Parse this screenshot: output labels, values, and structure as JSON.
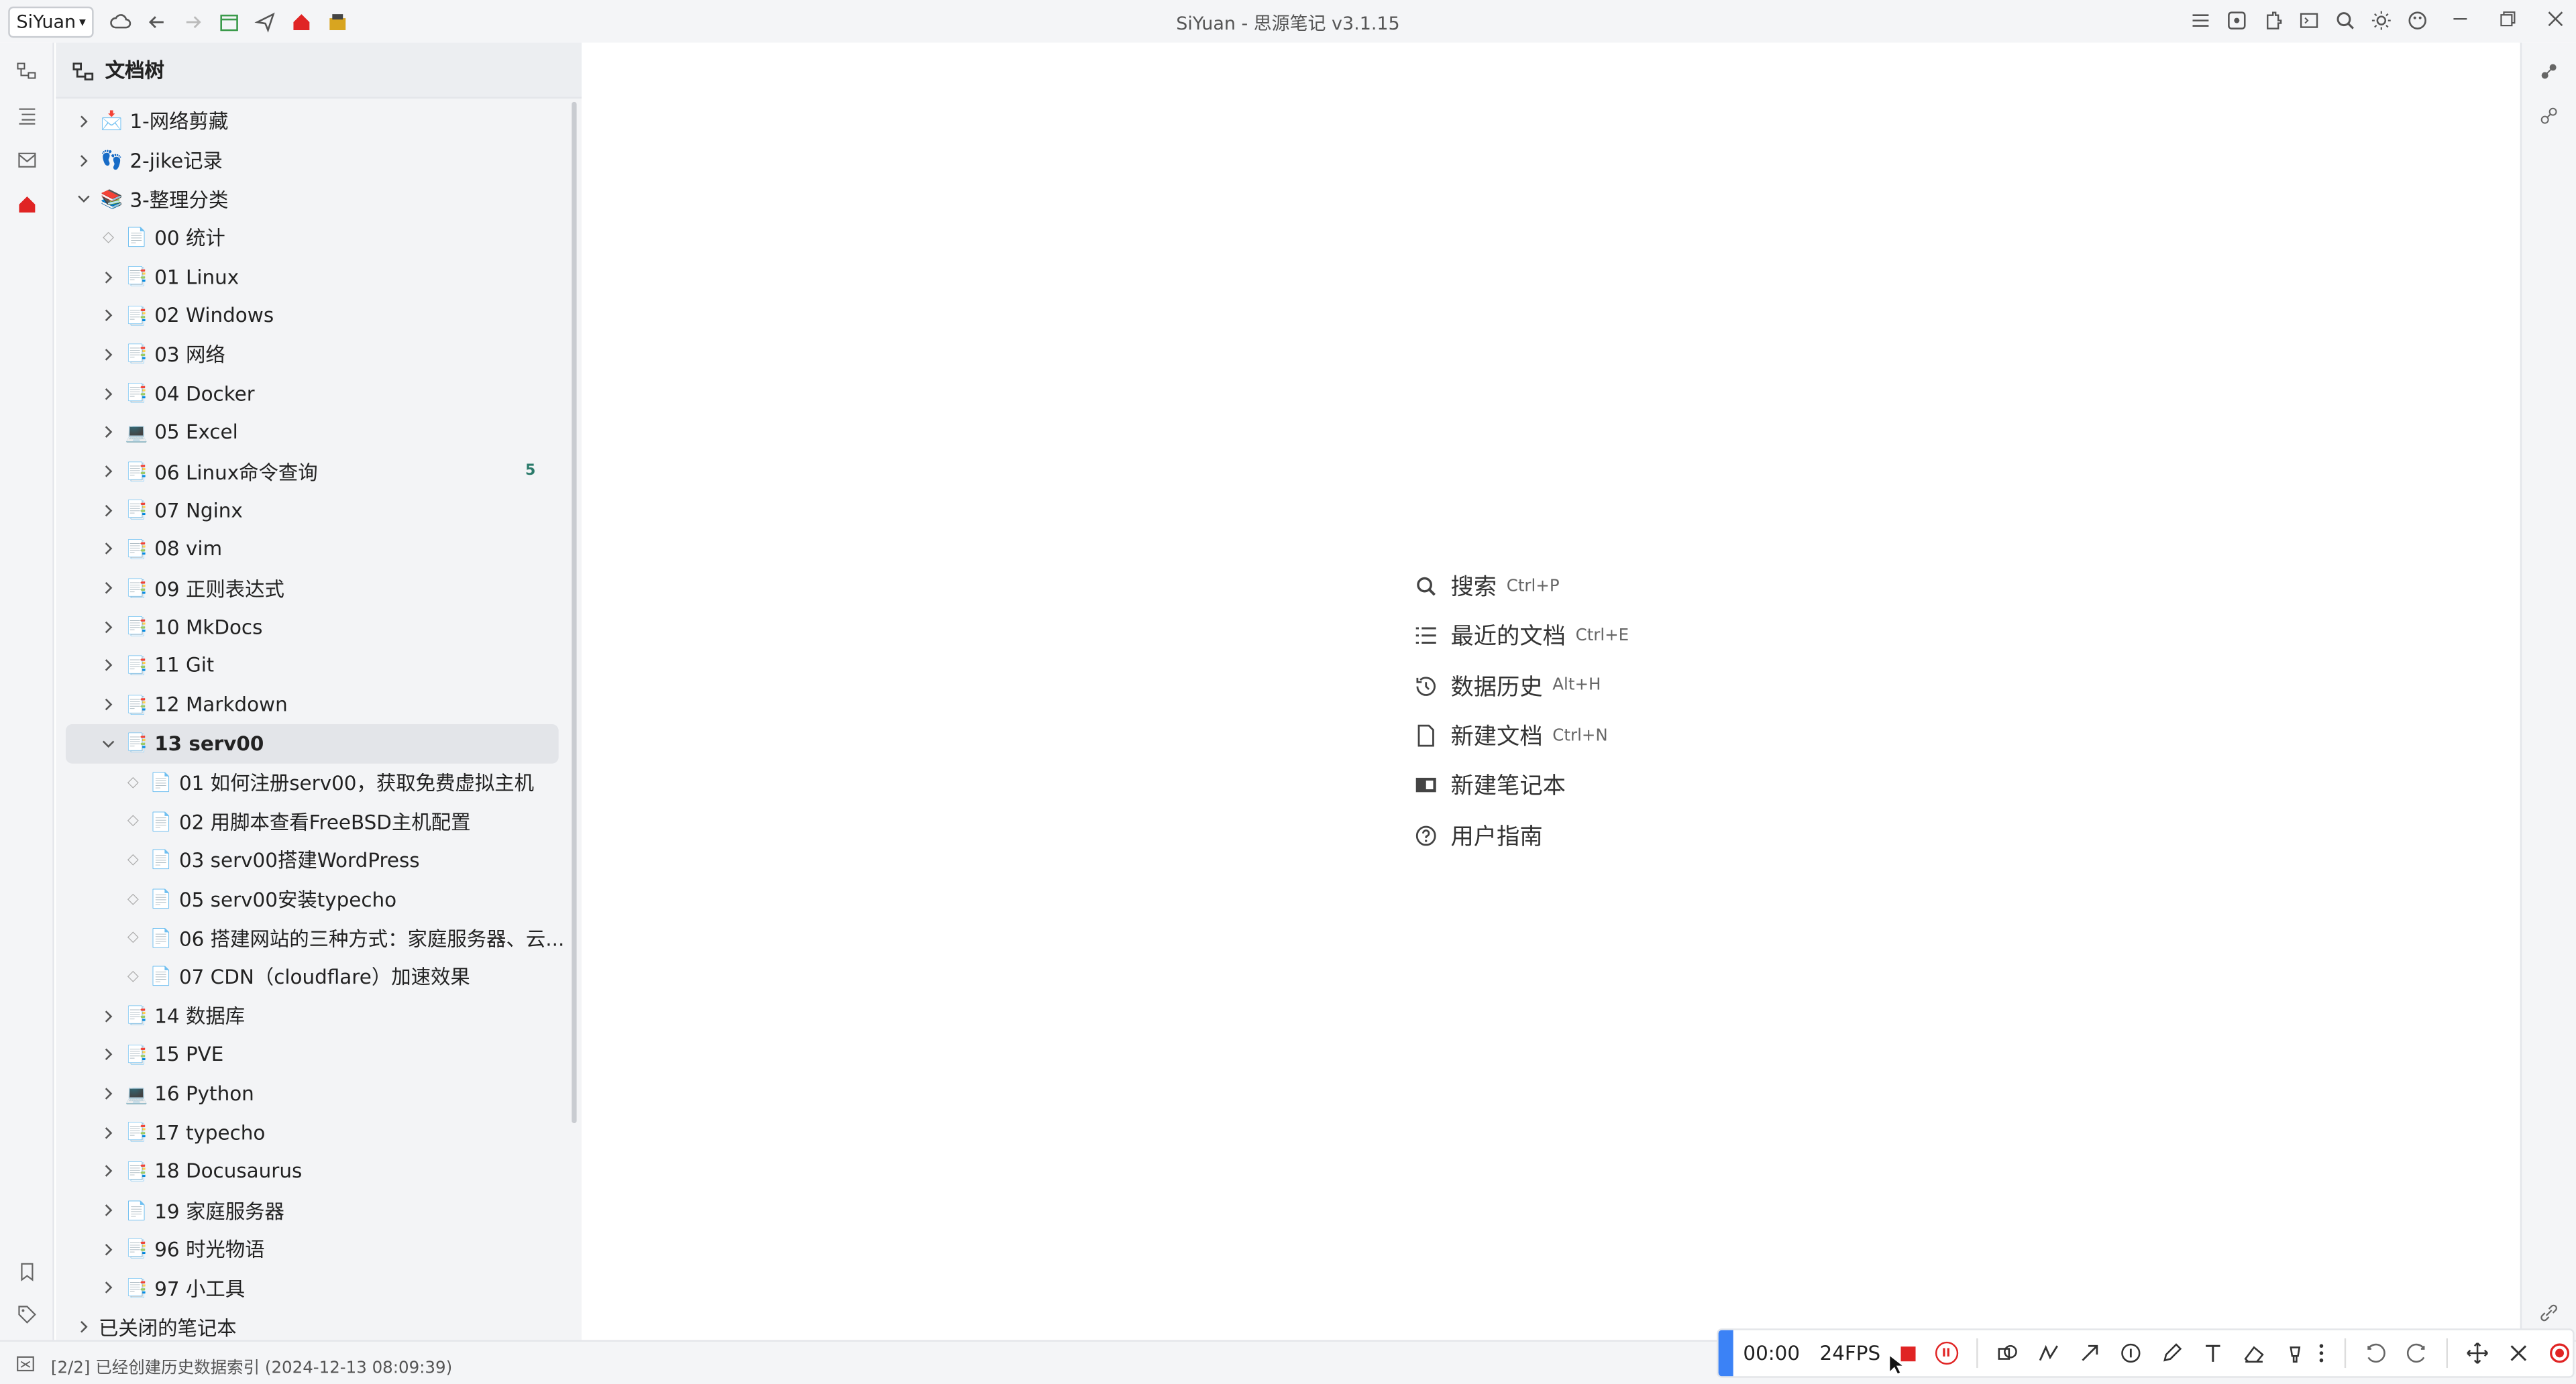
{
  "window": {
    "app_menu": "SiYuan",
    "title": "SiYuan - 思源笔记 v3.1.15"
  },
  "panel": {
    "title": "文档树"
  },
  "tree": [
    {
      "label": "1-网络剪藏",
      "emoji": "📩",
      "level": 0,
      "expandable": true,
      "expanded": false
    },
    {
      "label": "2-jike记录",
      "emoji": "👣",
      "level": 0,
      "expandable": true,
      "expanded": false
    },
    {
      "label": "3-整理分类",
      "emoji": "📚",
      "level": 0,
      "expandable": true,
      "expanded": true
    },
    {
      "label": "00 统计",
      "emoji": "📄",
      "level": 1,
      "expandable": false
    },
    {
      "label": "01 Linux",
      "emoji": "📑",
      "level": 1,
      "expandable": true
    },
    {
      "label": "02 Windows",
      "emoji": "📑",
      "level": 1,
      "expandable": true
    },
    {
      "label": "03 网络",
      "emoji": "📑",
      "level": 1,
      "expandable": true
    },
    {
      "label": "04 Docker",
      "emoji": "📑",
      "level": 1,
      "expandable": true
    },
    {
      "label": "05 Excel",
      "emoji": "💻",
      "level": 1,
      "expandable": true
    },
    {
      "label": "06 Linux命令查询",
      "emoji": "📑",
      "level": 1,
      "expandable": true,
      "count": "5"
    },
    {
      "label": "07 Nginx",
      "emoji": "📑",
      "level": 1,
      "expandable": true
    },
    {
      "label": "08 vim",
      "emoji": "📑",
      "level": 1,
      "expandable": true
    },
    {
      "label": "09 正则表达式",
      "emoji": "📑",
      "level": 1,
      "expandable": true
    },
    {
      "label": "10 MkDocs",
      "emoji": "📑",
      "level": 1,
      "expandable": true
    },
    {
      "label": "11 Git",
      "emoji": "📑",
      "level": 1,
      "expandable": true
    },
    {
      "label": "12 Markdown",
      "emoji": "📑",
      "level": 1,
      "expandable": true
    },
    {
      "label": "13 serv00",
      "emoji": "📑",
      "level": 1,
      "expandable": true,
      "expanded": true,
      "active": true
    },
    {
      "label": "01 如何注册serv00，获取免费虚拟主机",
      "emoji": "📄",
      "level": 2,
      "expandable": false
    },
    {
      "label": "02 用脚本查看FreeBSD主机配置",
      "emoji": "📄",
      "level": 2,
      "expandable": false
    },
    {
      "label": "03 serv00搭建WordPress",
      "emoji": "📄",
      "level": 2,
      "expandable": false
    },
    {
      "label": "05 serv00安装typecho",
      "emoji": "📄",
      "level": 2,
      "expandable": false
    },
    {
      "label": "06 搭建网站的三种方式：家庭服务器、云...",
      "emoji": "📄",
      "level": 2,
      "expandable": false
    },
    {
      "label": "07 CDN（cloudflare）加速效果",
      "emoji": "📄",
      "level": 2,
      "expandable": false
    },
    {
      "label": "14 数据库",
      "emoji": "📑",
      "level": 1,
      "expandable": true
    },
    {
      "label": "15 PVE",
      "emoji": "📑",
      "level": 1,
      "expandable": true
    },
    {
      "label": "16 Python",
      "emoji": "💻",
      "level": 1,
      "expandable": true
    },
    {
      "label": "17 typecho",
      "emoji": "📑",
      "level": 1,
      "expandable": true
    },
    {
      "label": "18 Docusaurus",
      "emoji": "📑",
      "level": 1,
      "expandable": true
    },
    {
      "label": "19 家庭服务器",
      "emoji": "📄",
      "level": 1,
      "expandable": true
    },
    {
      "label": "96 时光物语",
      "emoji": "📑",
      "level": 1,
      "expandable": true
    },
    {
      "label": "97 小工具",
      "emoji": "📑",
      "level": 1,
      "expandable": true
    },
    {
      "label": "已关闭的笔记本",
      "emoji": "",
      "level": -1,
      "expandable": true
    }
  ],
  "empty_menu": [
    {
      "label": "搜索",
      "shortcut": "Ctrl+P",
      "icon": "search-icon"
    },
    {
      "label": "最近的文档",
      "shortcut": "Ctrl+E",
      "icon": "list-icon"
    },
    {
      "label": "数据历史",
      "shortcut": "Alt+H",
      "icon": "history-icon"
    },
    {
      "label": "新建文档",
      "shortcut": "Ctrl+N",
      "icon": "file-icon"
    },
    {
      "label": "新建笔记本",
      "shortcut": "",
      "icon": "notebook-icon"
    },
    {
      "label": "用户指南",
      "shortcut": "",
      "icon": "help-icon"
    }
  ],
  "status": {
    "text": "[2/2] 已经创建历史数据索引 (2024-12-13 08:09:39)"
  },
  "recorder": {
    "time": "00:00",
    "fps": "24FPS"
  },
  "colors": {
    "accent_red": "#e02424",
    "accent_blue": "#3b82f6",
    "count_green": "#2a7a6a"
  }
}
